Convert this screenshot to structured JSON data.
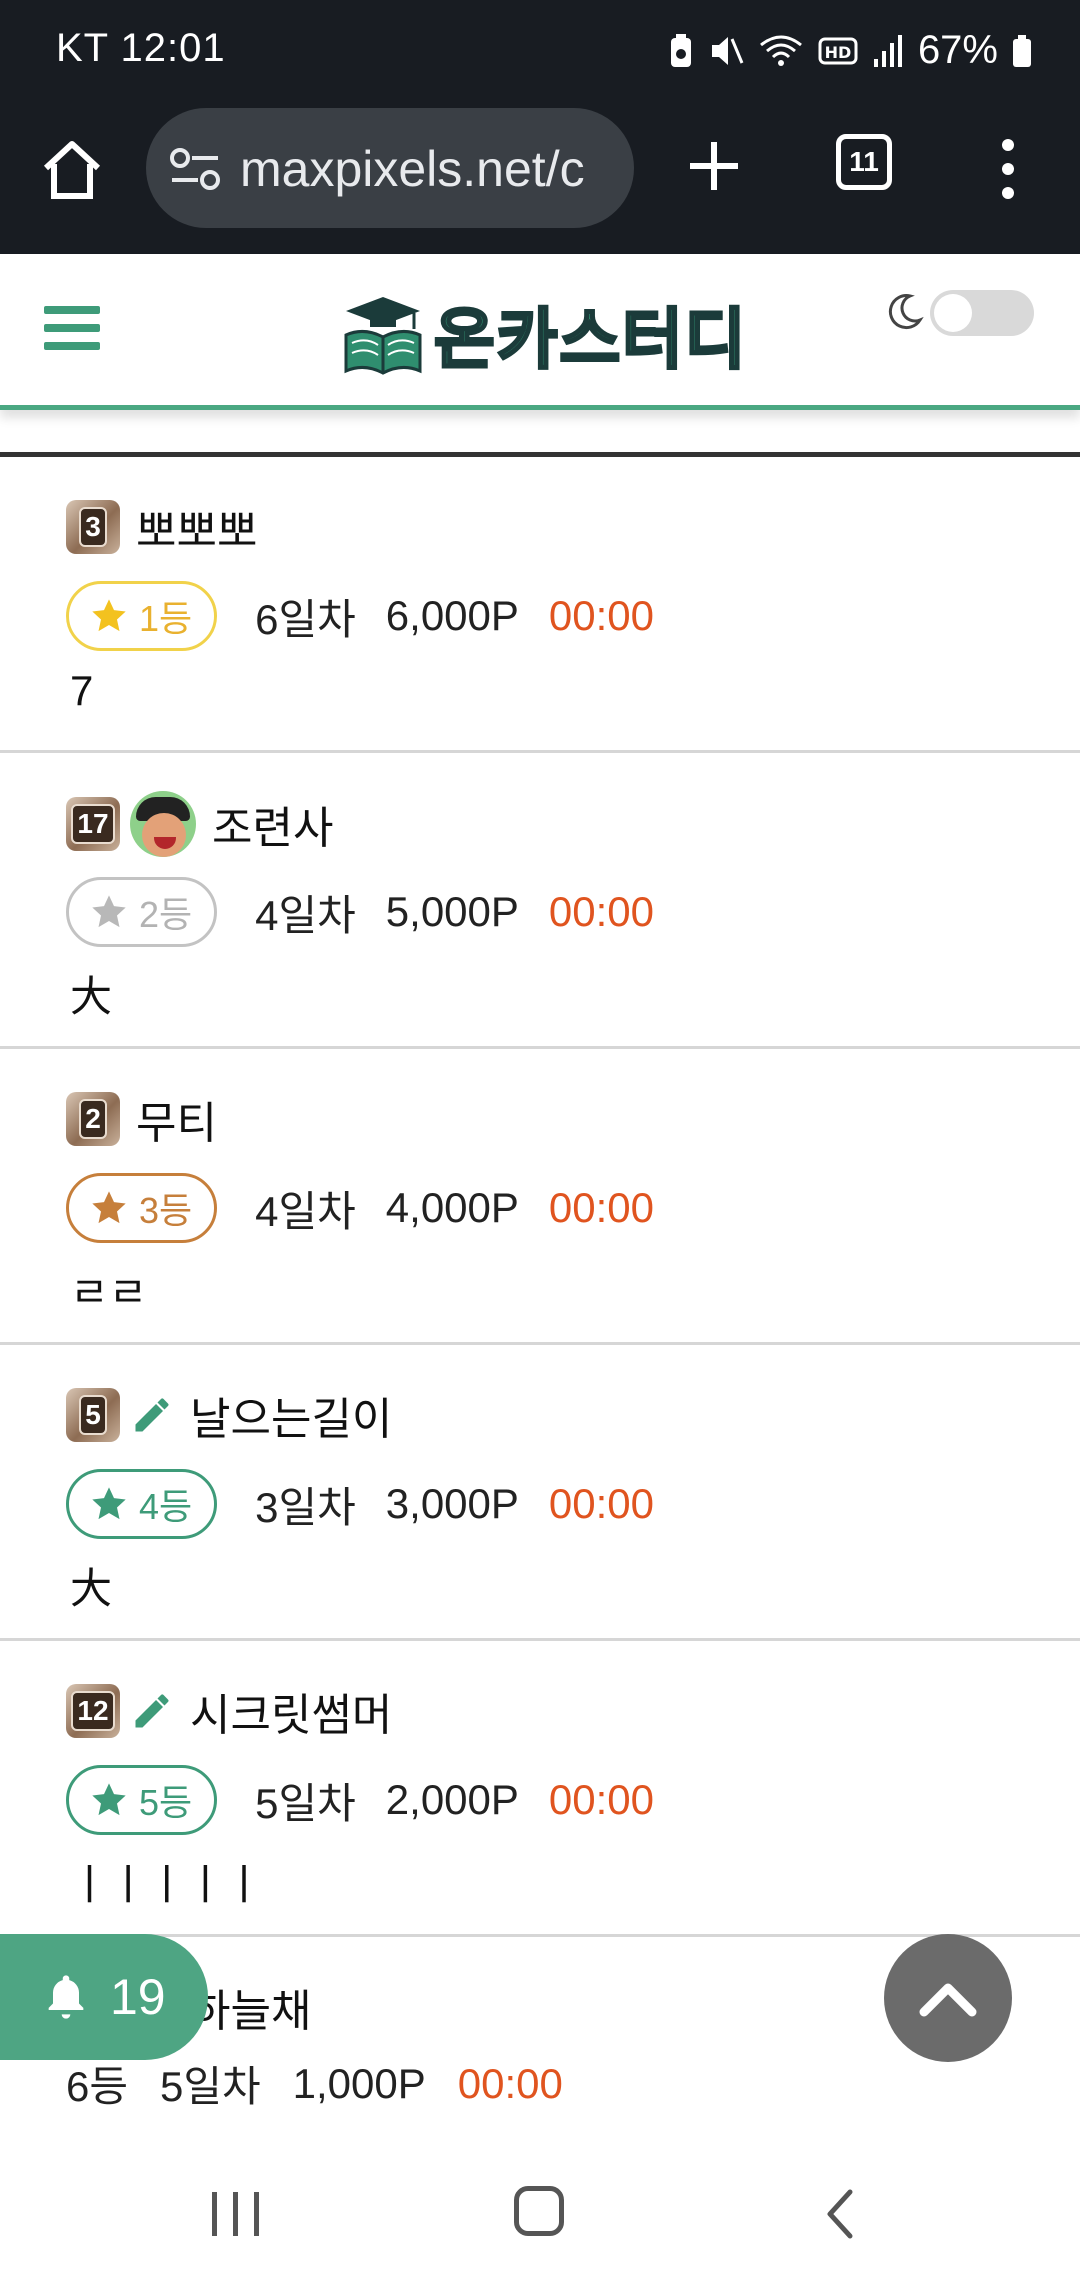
{
  "status_bar": {
    "carrier": "KT",
    "time": "12:01",
    "battery": "67%"
  },
  "browser": {
    "url": "maxpixels.net/c",
    "tab_count": "11"
  },
  "site": {
    "logo_text": "온카스터디",
    "dark_mode_enabled": false
  },
  "list": {
    "items": [
      {
        "level": "3",
        "name": "뽀뽀뽀",
        "rank": "1등",
        "days": "6일차",
        "points": "6,000P",
        "time": "00:00",
        "comment": "7"
      },
      {
        "level": "17",
        "name": "조련사",
        "rank": "2등",
        "days": "4일차",
        "points": "5,000P",
        "time": "00:00",
        "comment": "大"
      },
      {
        "level": "2",
        "name": "무티",
        "rank": "3등",
        "days": "4일차",
        "points": "4,000P",
        "time": "00:00",
        "comment": "ㄹㄹ"
      },
      {
        "level": "5",
        "name": "날으는길이",
        "rank": "4등",
        "days": "3일차",
        "points": "3,000P",
        "time": "00:00",
        "comment": "大"
      },
      {
        "level": "12",
        "name": "시크릿썸머",
        "rank": "5등",
        "days": "5일차",
        "points": "2,000P",
        "time": "00:00",
        "comment": "ㅣㅣㅣㅣㅣ"
      },
      {
        "name": "하늘채",
        "rank": "6등",
        "days": "5일차",
        "points": "1,000P",
        "time": "00:00"
      }
    ]
  },
  "notifications": {
    "count": "19"
  },
  "colors": {
    "brand_green": "#4ea583",
    "time_orange": "#e0541f",
    "gold": "#f1d24a",
    "silver": "#c3c3c3",
    "bronze": "#c67f3b"
  }
}
